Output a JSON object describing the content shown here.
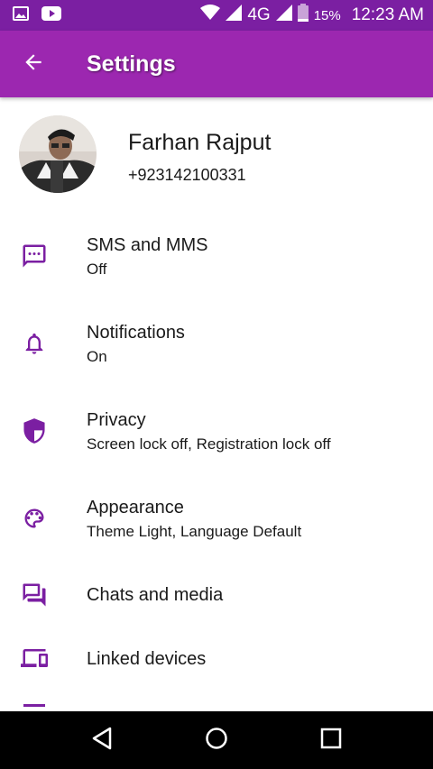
{
  "status_bar": {
    "signal_label": "4G",
    "battery_percent": "15%",
    "time": "12:23 AM",
    "icons": [
      "image-icon",
      "youtube-icon",
      "wifi-icon",
      "signal-icon",
      "battery-icon"
    ]
  },
  "app_bar": {
    "title": "Settings",
    "back_icon": "arrow-left-icon",
    "background_color": "#9c27b0"
  },
  "profile": {
    "name": "Farhan Rajput",
    "phone": "+923142100331"
  },
  "settings": {
    "sms": {
      "title": "SMS and MMS",
      "subtitle": "Off",
      "icon": "chat-bubble-icon"
    },
    "notifications": {
      "title": "Notifications",
      "subtitle": "On",
      "icon": "bell-icon"
    },
    "privacy": {
      "title": "Privacy",
      "subtitle": "Screen lock off, Registration lock off",
      "icon": "shield-icon"
    },
    "appearance": {
      "title": "Appearance",
      "subtitle": "Theme Light, Language Default",
      "icon": "palette-icon"
    },
    "chats": {
      "title": "Chats and media",
      "icon": "chats-icon"
    },
    "linked": {
      "title": "Linked devices",
      "icon": "devices-icon"
    }
  },
  "accent_color": "#7b1fa2",
  "nav_bar": {
    "icons": [
      "back-triangle-icon",
      "home-circle-icon",
      "recents-square-icon"
    ]
  }
}
